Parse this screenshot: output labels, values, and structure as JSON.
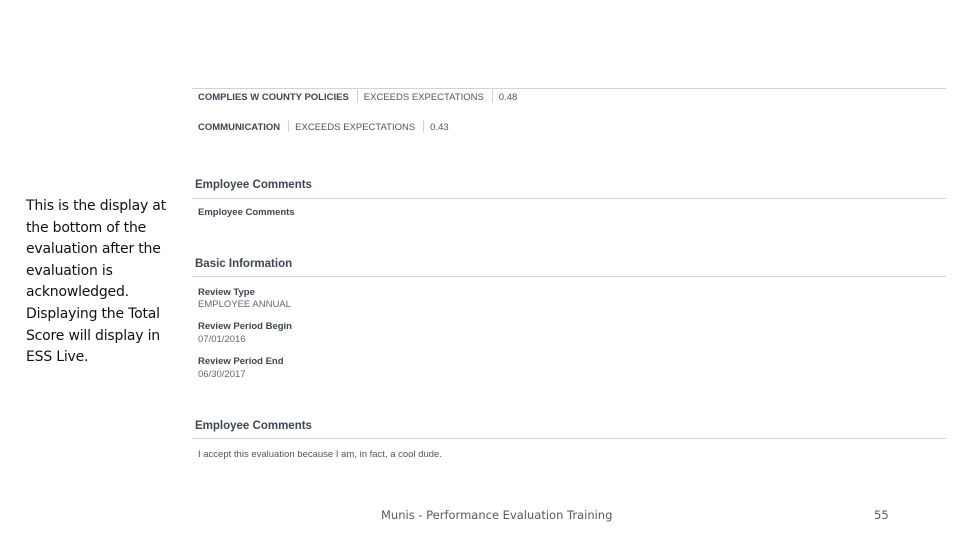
{
  "caption": "This is the display at the bottom of the evaluation after the evaluation is acknowledged. Displaying the Total Score will display in ESS Live.",
  "criteria": [
    {
      "label": "COMPLIES W COUNTY POLICIES",
      "rating": "EXCEEDS EXPECTATIONS",
      "score": "0.48"
    },
    {
      "label": "COMMUNICATION",
      "rating": "EXCEEDS EXPECTATIONS",
      "score": "0.43"
    }
  ],
  "employee_comments_section": {
    "heading": "Employee Comments",
    "field_label": "Employee Comments"
  },
  "basic_information": {
    "heading": "Basic Information",
    "review_type_label": "Review Type",
    "review_type_value": "EMPLOYEE ANNUAL",
    "period_begin_label": "Review Period Begin",
    "period_begin_value": "07/01/2016",
    "period_end_label": "Review Period End",
    "period_end_value": "06/30/2017"
  },
  "employee_comments_final": {
    "heading": "Employee Comments",
    "text": "I accept this evaluation because I am, in fact, a cool dude."
  },
  "footer": {
    "title": "Munis - Performance Evaluation Training",
    "page_number": "55"
  }
}
